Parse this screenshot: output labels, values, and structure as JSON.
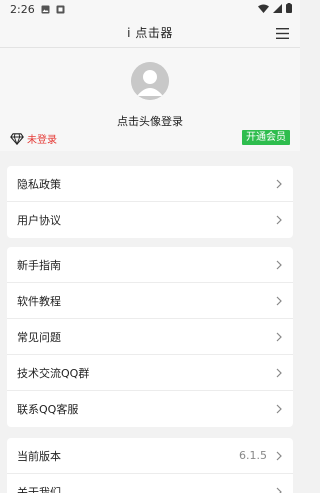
{
  "status_bar": {
    "time": "2:26"
  },
  "header": {
    "title": "i 点击器"
  },
  "profile": {
    "login_hint": "点击头像登录",
    "vip_status": "未登录",
    "vip_button": "开通会员"
  },
  "groups": [
    {
      "items": [
        {
          "label": "隐私政策"
        },
        {
          "label": "用户协议"
        }
      ]
    },
    {
      "items": [
        {
          "label": "新手指南"
        },
        {
          "label": "软件教程"
        },
        {
          "label": "常见问题"
        },
        {
          "label": "技术交流QQ群"
        },
        {
          "label": "联系QQ客服"
        }
      ]
    },
    {
      "items": [
        {
          "label": "当前版本",
          "value": "6.1.5"
        },
        {
          "label": "关于我们"
        }
      ]
    }
  ],
  "colors": {
    "vip_text": "#e53935",
    "vip_button_bg": "#2ebd4e"
  }
}
